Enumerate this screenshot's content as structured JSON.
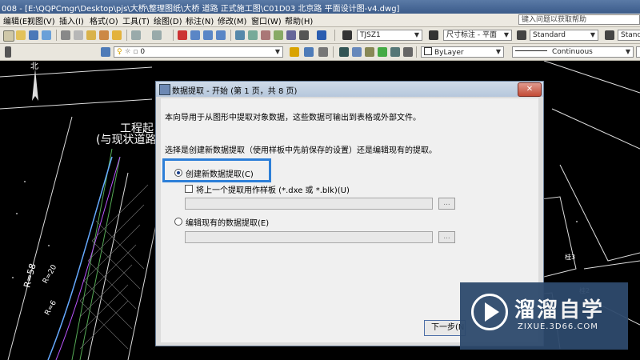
{
  "window": {
    "title": "008 - [E:\\QQPCmgr\\Desktop\\pjs\\大桥\\整理图纸\\大桥 道路 正式施工图\\C01D03 北京路 平面设计图-v4.dwg]"
  },
  "menu": {
    "items": [
      "编辑(E)",
      "视图(V)",
      "插入(I)",
      "格式(O)",
      "工具(T)",
      "绘图(D)",
      "标注(N)",
      "修改(M)",
      "窗口(W)",
      "帮助(H)"
    ],
    "help_placeholder": "键入问题以获取帮助"
  },
  "toolbar": {
    "text_style": "TJSZ1",
    "dim_style": "尺寸标注 - 平面",
    "table_style": "Standard",
    "layer": "0",
    "color": "ByLayer",
    "linetype": "Continuous"
  },
  "drawing": {
    "labels": [
      "工程起",
      "(与现状道路",
      "北",
      "R=58",
      "R=20",
      "R=6",
      "桂3",
      "桂2"
    ]
  },
  "dialog": {
    "title": "数据提取 - 开始 (第 1 页，共 8 页)",
    "intro": "本向导用于从图形中提取对象数据，这些数据可输出到表格或外部文件。",
    "prompt": "选择是创建新数据提取（使用样板中先前保存的设置）还是编辑现有的提取。",
    "option_create": "创建新数据提取(C)",
    "option_template": "将上一个提取用作样板 (*.dxe 或 *.blk)(U)",
    "option_edit": "编辑现有的数据提取(E)",
    "browse_label": "...",
    "next_label": "下一步(N) >",
    "close_label": "✕"
  },
  "watermark": {
    "name": "溜溜自学",
    "url": "ZIXUE.3D66.COM"
  }
}
